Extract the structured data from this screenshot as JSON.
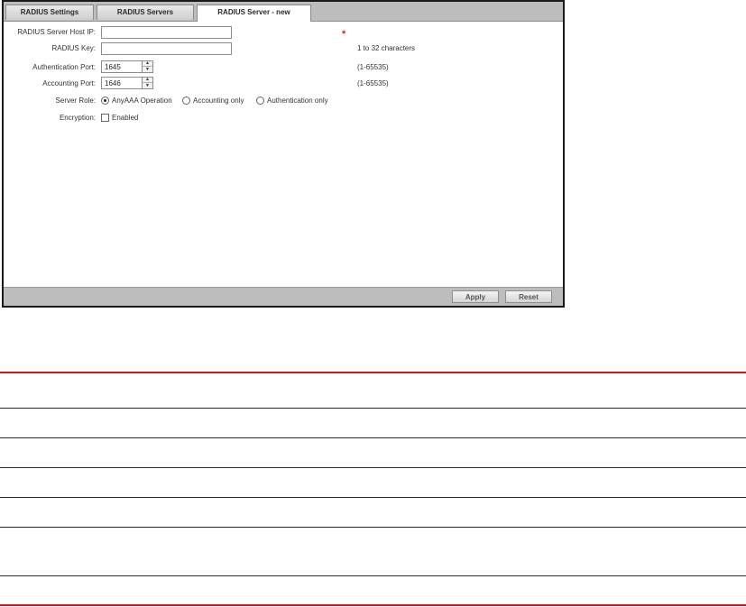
{
  "tabs": [
    {
      "label": "RADIUS Settings"
    },
    {
      "label": "RADIUS Servers"
    },
    {
      "label": "RADIUS Server - new",
      "active": true
    }
  ],
  "form": {
    "host_ip": {
      "label": "RADIUS Server Host IP:",
      "value": "",
      "required_mark": "*"
    },
    "key": {
      "label": "RADIUS Key:",
      "value": "",
      "hint": "1 to 32 characters"
    },
    "auth_port": {
      "label": "Authentication Port:",
      "value": "1645",
      "hint": "(1-65535)"
    },
    "acct_port": {
      "label": "Accounting Port:",
      "value": "1646",
      "hint": "(1-65535)"
    },
    "server_role": {
      "label": "Server Role:",
      "options": [
        {
          "label": "AnyAAA Operation",
          "selected": true
        },
        {
          "label": "Accounting only",
          "selected": false
        },
        {
          "label": "Authentication only",
          "selected": false
        }
      ]
    },
    "encryption": {
      "label": "Encryption:",
      "option_label": "Enabled",
      "checked": false
    }
  },
  "footer": {
    "apply_label": "Apply",
    "reset_label": "Reset"
  },
  "colors": {
    "required": "#e0191f",
    "rule_red": "#d4141a",
    "chrome": "#bdbdbd"
  }
}
